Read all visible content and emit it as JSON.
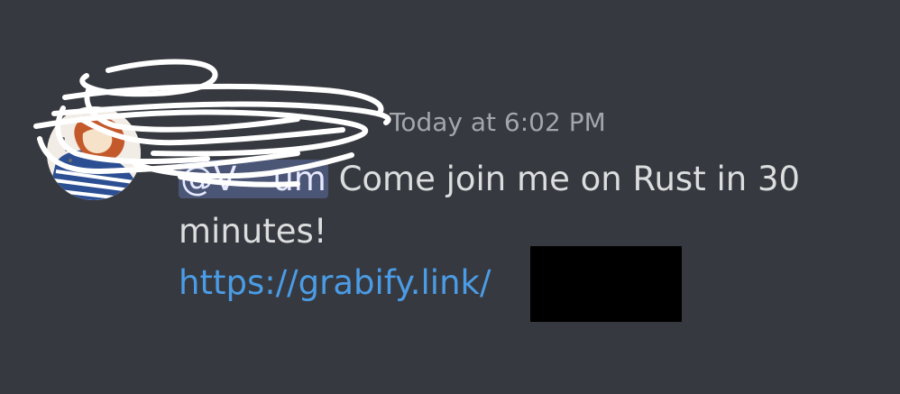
{
  "message": {
    "username": "",
    "timestamp": "Today at 6:02 PM",
    "mention": "@V",
    "mention_tail": "um",
    "body": " Come join me on Rust in 30",
    "body_line2": "minutes!",
    "link": "https://grabify.link/"
  },
  "colors": {
    "background": "#36393f",
    "link": "#4b9ce6",
    "mention_bg": "#5b6494",
    "text": "#dcddde",
    "timestamp": "#a3a6aa",
    "redaction": "#000000"
  }
}
